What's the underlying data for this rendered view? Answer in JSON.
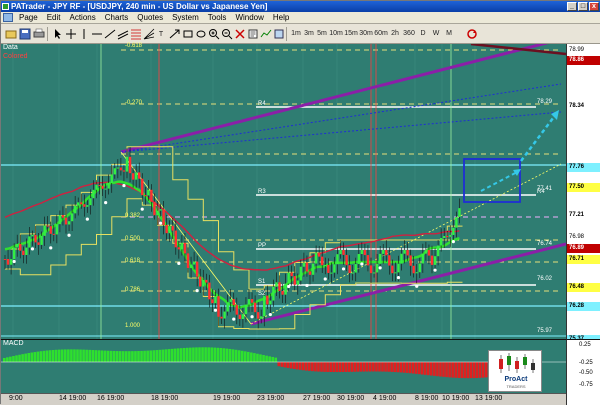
{
  "window": {
    "title": "PATrader - JPY RF - [USDJPY, 240 min - US Dollar vs Japanese Yen]",
    "min_label": "_",
    "max_label": "□",
    "close_label": "x"
  },
  "menu": [
    "Page",
    "Edit",
    "Actions",
    "Charts",
    "Quotes",
    "System",
    "Tools",
    "Window",
    "Help"
  ],
  "toolbar": {
    "timeframes": [
      "1m",
      "3m",
      "5m",
      "10m",
      "15m",
      "30m",
      "60m",
      "2h",
      "360",
      "D",
      "W",
      "M"
    ]
  },
  "chart": {
    "data_label": "Data",
    "indicator_label": "Colored",
    "macd_label": "MACD",
    "fib_labels": [
      "-0.618",
      "-0.270",
      "0.382",
      "0.500",
      "0.618",
      "0.786",
      "1.000"
    ],
    "level_labels": [
      "R4",
      "R3",
      "PP",
      "S1",
      "S2",
      "R4"
    ],
    "small_levels": [
      "78.29",
      "77.41",
      "76.74",
      "76.02",
      "75.97"
    ],
    "price_labels": [
      "78.99",
      "78.86",
      "78.34",
      "77.76",
      "77.50",
      "77.21",
      "76.98",
      "76.89",
      "76.71",
      "76.48",
      "76.28",
      "75.37"
    ],
    "macd_ticks": [
      "0.25",
      "-0.25",
      "-0.50",
      "-0.75"
    ],
    "time_labels": [
      "9:00",
      "14 19:00",
      "16 19:00",
      "18 19:00",
      "19 19:00",
      "23 19:00",
      "27 19:00",
      "30 19:00",
      "4 19:00",
      "8 19:00",
      "10 19:00",
      "13 19:00"
    ],
    "colors": {
      "background": "#2f7d72",
      "channel": "#8b1fa8",
      "projection": "#1e2fd4",
      "target_arrow": "#35c8e8"
    }
  },
  "logo": {
    "name": "ProAct",
    "sub": "TRADERS"
  }
}
